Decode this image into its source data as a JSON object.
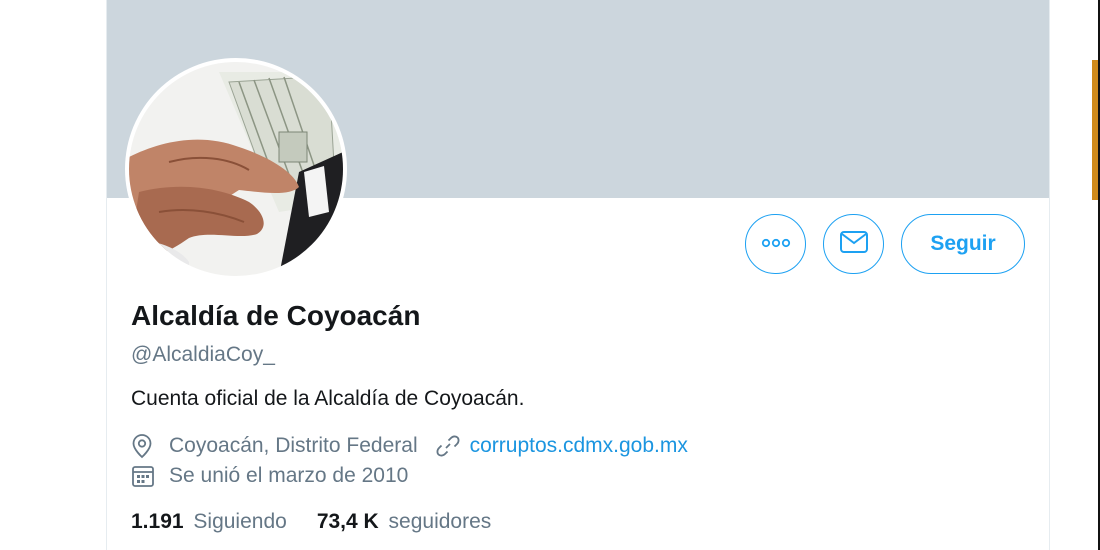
{
  "profile": {
    "name": "Alcaldía de Coyoacán",
    "handle": "@AlcaldiaCoy_",
    "bio": "Cuenta oficial de la Alcaldía de Coyoacán.",
    "location": "Coyoacán, Distrito Federal",
    "website": "corruptos.cdmx.gob.mx",
    "joined": "Se unió el marzo de 2010"
  },
  "stats": {
    "following_count": "1.191",
    "following_label": "Siguiendo",
    "followers_count": "73,4 K",
    "followers_label": "seguidores"
  },
  "actions": {
    "follow_label": "Seguir"
  },
  "icons": {
    "more": "more-options-icon",
    "message": "envelope-icon",
    "location": "location-pin-icon",
    "link": "link-icon",
    "calendar": "calendar-icon"
  },
  "colors": {
    "accent": "#1da1f2",
    "link": "#1b95e0",
    "banner": "#ccd6dd",
    "secondary_text": "#657786"
  }
}
